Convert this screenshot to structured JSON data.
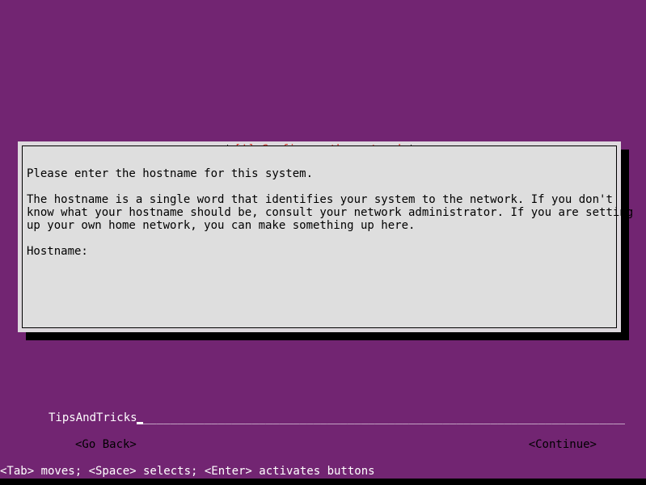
{
  "screen": {
    "background_color": "#722572",
    "text_color": "#ffffff"
  },
  "dialog": {
    "title": "[!] Configure the network",
    "title_color": "#d43b30",
    "frame_color": "#000000",
    "content_bg": "#dedede",
    "border_bg": "#ded9de",
    "shadow_color": "#000000",
    "intro": "Please enter the hostname for this system.",
    "body_lines": [
      "The hostname is a single word that identifies your system to the network. If you don't",
      "know what your hostname should be, consult your network administrator. If you are setting",
      "up your own home network, you can make something up here."
    ],
    "field_label": "Hostname:",
    "input": {
      "value": "TipsAndTricks",
      "fill": "____________________________________________________________________________",
      "bg_color": "#722572",
      "text_color": "#ffffff"
    },
    "buttons": {
      "go_back": "<Go Back>",
      "continue": "<Continue>"
    }
  },
  "statusbar": {
    "hint": "<Tab> moves; <Space> selects; <Enter> activates buttons"
  }
}
